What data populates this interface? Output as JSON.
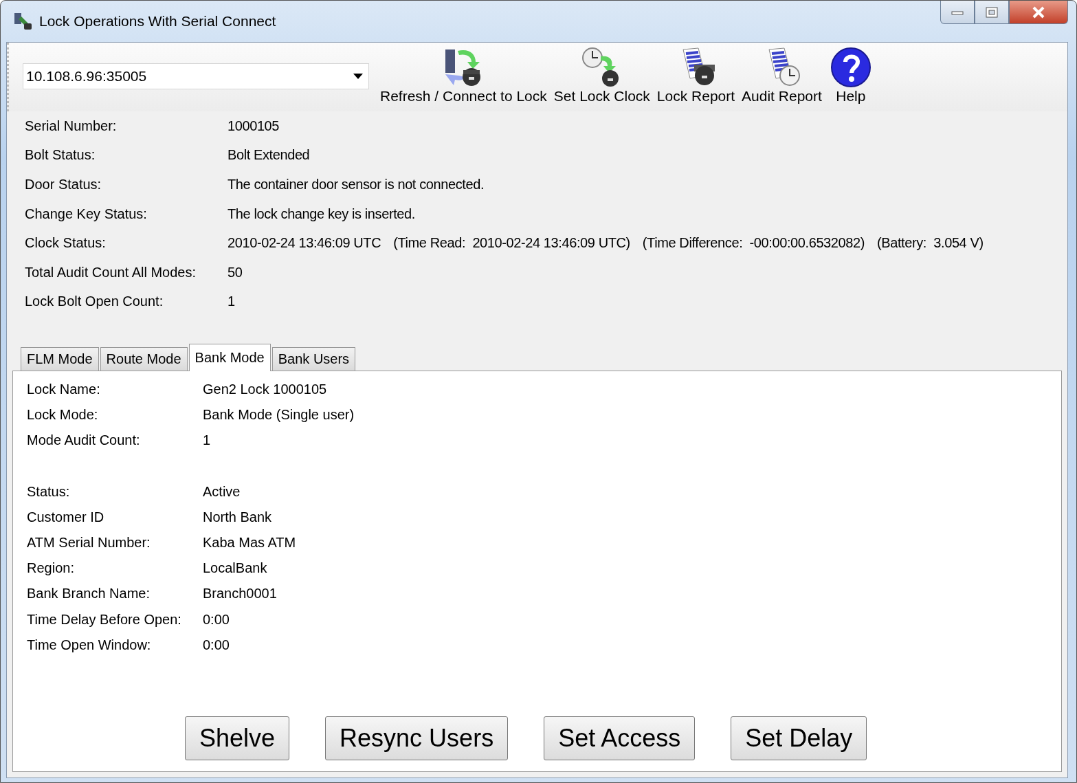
{
  "window": {
    "title": "Lock Operations With Serial Connect"
  },
  "connection": {
    "value": "10.108.6.96:35005"
  },
  "toolbar": [
    {
      "kind": "refresh",
      "label": "Refresh / Connect to Lock"
    },
    {
      "kind": "clock",
      "label": "Set Lock Clock"
    },
    {
      "kind": "lock_report",
      "label": "Lock Report"
    },
    {
      "kind": "audit_report",
      "label": "Audit Report"
    },
    {
      "kind": "help",
      "label": "Help"
    }
  ],
  "info": [
    {
      "label": "Serial Number:",
      "parts": [
        "1000105"
      ]
    },
    {
      "label": "Bolt Status:",
      "parts": [
        "Bolt Extended"
      ]
    },
    {
      "label": "Door Status:",
      "parts": [
        "The container door sensor is not connected."
      ]
    },
    {
      "label": "Change Key Status:",
      "parts": [
        "The lock change key is inserted."
      ]
    },
    {
      "label": "Clock Status:",
      "parts": [
        "2010-02-24 13:46:09 UTC",
        "(Time Read:  2010-02-24 13:46:09 UTC)",
        "(Time Difference:  -00:00:00.6532082)",
        "(Battery:  3.054 V)"
      ]
    },
    {
      "label": "Total Audit Count All Modes:",
      "parts": [
        "50"
      ]
    },
    {
      "label": "Lock Bolt Open Count:",
      "parts": [
        "1"
      ]
    }
  ],
  "tabs": [
    {
      "label": "FLM Mode",
      "selected": false
    },
    {
      "label": "Route Mode",
      "selected": false
    },
    {
      "label": "Bank Mode",
      "selected": true
    },
    {
      "label": "Bank Users",
      "selected": false
    }
  ],
  "field_groups": [
    [
      {
        "label": "Lock Name:",
        "value": "Gen2 Lock 1000105"
      },
      {
        "label": "Lock Mode:",
        "value": "Bank Mode (Single user)"
      },
      {
        "label": "Mode Audit Count:",
        "value": "1"
      }
    ],
    [
      {
        "label": "Status:",
        "value": "Active"
      },
      {
        "label": "Customer ID",
        "value": "North Bank"
      },
      {
        "label": "ATM Serial Number:",
        "value": "Kaba Mas ATM"
      },
      {
        "label": "Region:",
        "value": "LocalBank"
      },
      {
        "label": "Bank Branch Name:",
        "value": "Branch0001"
      },
      {
        "label": "Time Delay Before Open:",
        "value": "0:00"
      },
      {
        "label": "Time Open Window:",
        "value": "0:00"
      }
    ]
  ],
  "buttons": [
    "Shelve",
    "Resync Users",
    "Set Access",
    "Set Delay"
  ]
}
